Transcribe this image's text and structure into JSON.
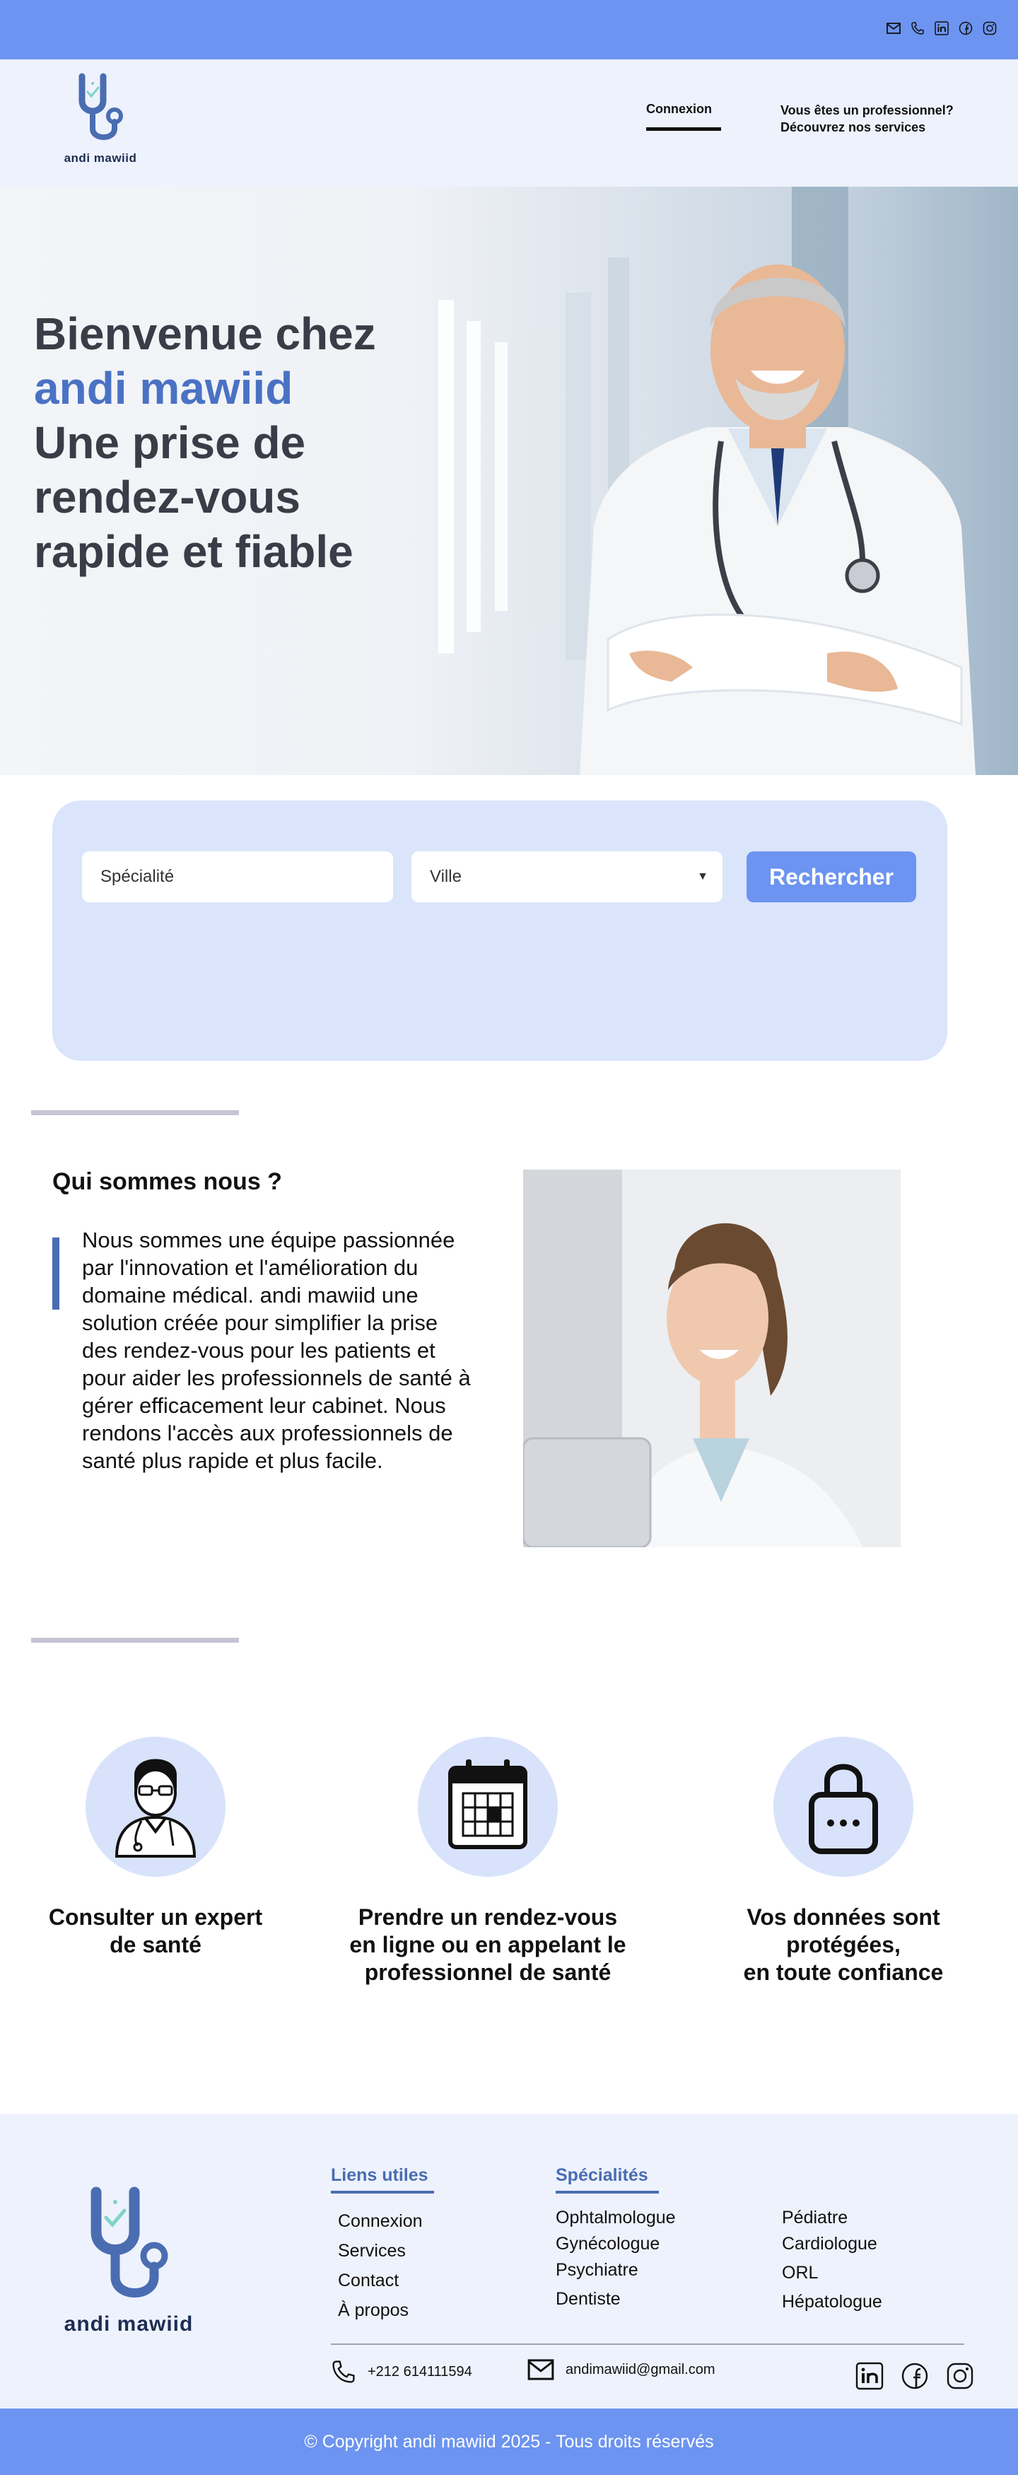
{
  "topbar": {
    "icons": [
      "envelope-icon",
      "phone-icon",
      "linkedin-icon",
      "facebook-icon",
      "instagram-icon"
    ]
  },
  "header": {
    "brand": "andi mawiid",
    "login": "Connexion",
    "pro_line1": "Vous êtes un professionnel?",
    "pro_line2": "Découvrez nos services"
  },
  "hero": {
    "line1": "Bienvenue chez",
    "brand": "andi mawiid",
    "line3": "Une prise de",
    "line4": "rendez-vous",
    "line5": "rapide et fiable"
  },
  "search": {
    "specialite_placeholder": "Spécialité",
    "ville_value": "Ville",
    "button": "Rechercher"
  },
  "about": {
    "title": "Qui sommes nous ?",
    "text": "Nous sommes une équipe passionnée par l'innovation et l'amélioration du domaine médical. andi mawiid une solution créée pour simplifier la prise des rendez-vous pour les patients et pour aider les professionnels de santé à gérer efficacement leur cabinet. Nous rendons l'accès aux professionnels de santé plus rapide et plus facile."
  },
  "features": [
    {
      "line1": "Consulter un expert",
      "line2": "de santé",
      "line3": ""
    },
    {
      "line1": "Prendre un rendez-vous",
      "line2": "en ligne ou en appelant le",
      "line3": "professionnel de santé"
    },
    {
      "line1": "Vos données sont",
      "line2": "protégées,",
      "line3": "en toute confiance"
    }
  ],
  "footer": {
    "brand": "andi mawiid",
    "liens_title": "Liens utiles",
    "liens": [
      "Connexion",
      "Services",
      "Contact",
      "À propos"
    ],
    "specialites_title": "Spécialités",
    "specialites_col1": [
      "Ophtalmologue",
      "Gynécologue",
      "Psychiatre",
      "Dentiste"
    ],
    "specialites_col2": [
      "Pédiatre",
      "Cardiologue",
      "ORL",
      "Hépatologue"
    ],
    "phone": "+212 614111594",
    "email": "andimawiid@gmail.com"
  },
  "copyright": "© Copyright andi mawiid 2025 - Tous droits réservés",
  "colors": {
    "accent": "#6c94f0",
    "brand_blue": "#4a72c4",
    "light_bg": "#eef2fd",
    "card_bg": "#dae5fb"
  }
}
